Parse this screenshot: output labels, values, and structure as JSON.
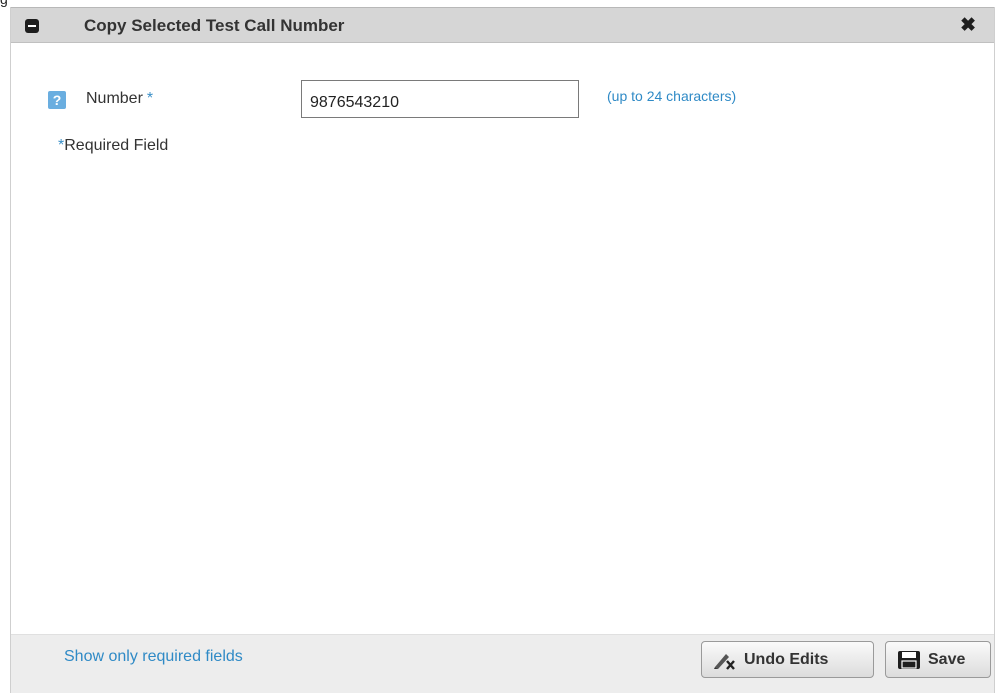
{
  "page": {
    "cut_label": "g"
  },
  "dialog": {
    "title": "Copy Selected Test Call Number",
    "close_glyph": "✖"
  },
  "form": {
    "number_field": {
      "label": "Number",
      "required_marker": "*",
      "value": "9876543210",
      "hint": "(up to 24 characters)",
      "help_glyph": "?"
    },
    "required_note": {
      "marker": "*",
      "text": "Required Field"
    }
  },
  "footer": {
    "show_required_label": "Show only required fields",
    "undo_label": "Undo Edits",
    "save_label": "Save"
  },
  "icons": {
    "collapse": "minus-square-icon",
    "close": "close-icon",
    "help": "help-icon",
    "undo": "pencil-x-icon",
    "save": "floppy-disk-icon"
  },
  "colors": {
    "titlebar_bg": "#d6d6d6",
    "link_blue": "#2f8ac6",
    "help_icon_bg": "#6aaee0",
    "footer_bg": "#ededed"
  }
}
